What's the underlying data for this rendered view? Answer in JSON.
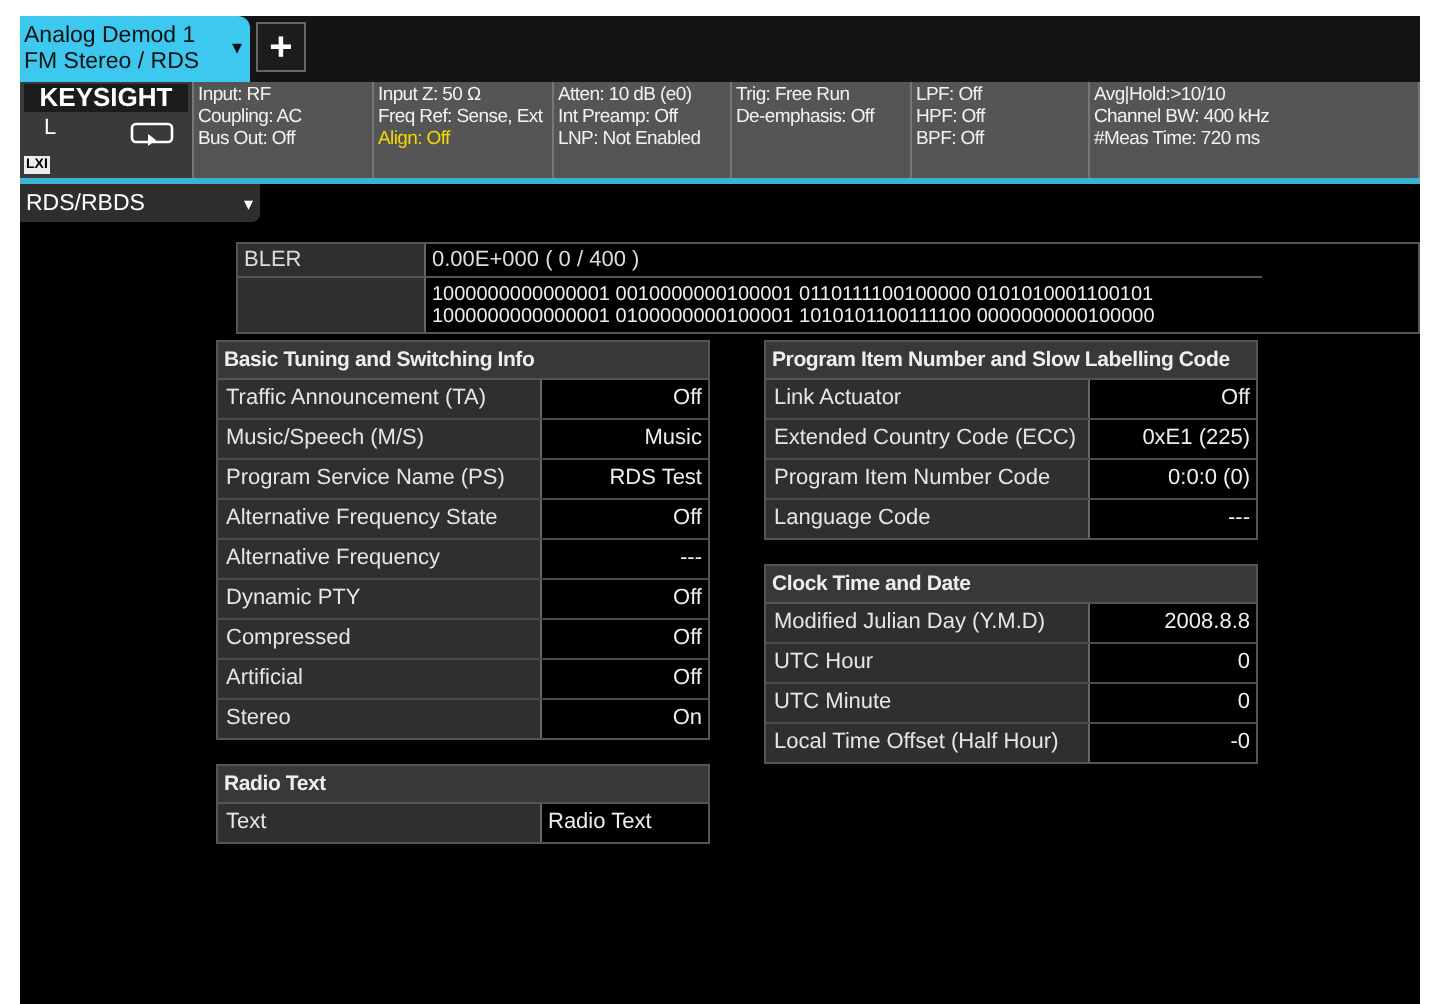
{
  "tabs": [
    {
      "title": "Analog Demod 1",
      "subtitle": "FM Stereo / RDS",
      "caret": "▾",
      "selected": true
    }
  ],
  "add_tab_button": "+",
  "brand": {
    "logo": "KEYSIGHT",
    "channel": "L",
    "badge": "LXI"
  },
  "settings": [
    [
      {
        "text": "Input: RF",
        "warning": false
      },
      {
        "text": "Coupling: AC",
        "warning": false
      },
      {
        "text": "Bus Out: Off",
        "warning": false
      }
    ],
    [
      {
        "text": "Input Z: 50 Ω",
        "warning": false
      },
      {
        "text": "Freq Ref: Sense, Ext",
        "warning": false
      },
      {
        "text": "Align: Off",
        "warning": true
      }
    ],
    [
      {
        "text": "Atten: 10 dB (e0)",
        "warning": false
      },
      {
        "text": "Int Preamp: Off",
        "warning": false
      },
      {
        "text": "LNP: Not Enabled",
        "warning": false
      }
    ],
    [
      {
        "text": "Trig: Free Run",
        "warning": false
      },
      {
        "text": "De-emphasis: Off",
        "warning": false
      }
    ],
    [
      {
        "text": "LPF: Off",
        "warning": false
      },
      {
        "text": "HPF: Off",
        "warning": false
      },
      {
        "text": "BPF: Off",
        "warning": false
      }
    ],
    [
      {
        "text": "Avg|Hold:>10/10",
        "warning": false
      },
      {
        "text": "Channel BW: 400 kHz",
        "warning": false
      },
      {
        "text": "#Meas Time: 720 ms",
        "warning": false
      }
    ]
  ],
  "view_dropdown": {
    "value": "RDS/RBDS",
    "caret": "▾"
  },
  "bler": {
    "label": "BLER",
    "value": "0.00E+000 ( 0 / 400 )",
    "bits": [
      "1000000000000001 0010000000100001 0110111100100000 0101010001100101",
      "1000000000000001 0100000000100001 1010101100111100 0000000000100000"
    ]
  },
  "tables": [
    {
      "title": "Basic Tuning and Switching Info",
      "kind": "status",
      "rows": [
        [
          "Traffic Announcement (TA)",
          "Off"
        ],
        [
          "Music/Speech (M/S)",
          "Music"
        ],
        [
          "Program Service Name (PS)",
          "RDS Test"
        ],
        [
          "Alternative Frequency State",
          "Off"
        ],
        [
          "Alternative Frequency",
          "---"
        ],
        [
          "Dynamic PTY",
          "Off"
        ],
        [
          "Compressed",
          "Off"
        ],
        [
          "Artificial",
          "Off"
        ],
        [
          "Stereo",
          "On"
        ]
      ]
    },
    {
      "title": "Radio Text",
      "kind": "text",
      "rows": [
        [
          "Text",
          "Radio Text"
        ]
      ]
    },
    {
      "title": "Program Item Number and Slow Labelling Code",
      "kind": "status",
      "rows": [
        [
          "Link Actuator",
          "Off"
        ],
        [
          "Extended Country Code (ECC)",
          "0xE1 (225)"
        ],
        [
          "Program Item Number Code",
          "0:0:0 (0)"
        ],
        [
          "Language Code",
          "---"
        ]
      ]
    },
    {
      "title": "Clock Time and Date",
      "kind": "status",
      "rows": [
        [
          "Modified Julian Day (Y.M.D)",
          "2008.8.8"
        ],
        [
          "UTC Hour",
          "0"
        ],
        [
          "UTC Minute",
          "0"
        ],
        [
          "Local Time Offset (Half Hour)",
          "-0"
        ]
      ]
    }
  ]
}
